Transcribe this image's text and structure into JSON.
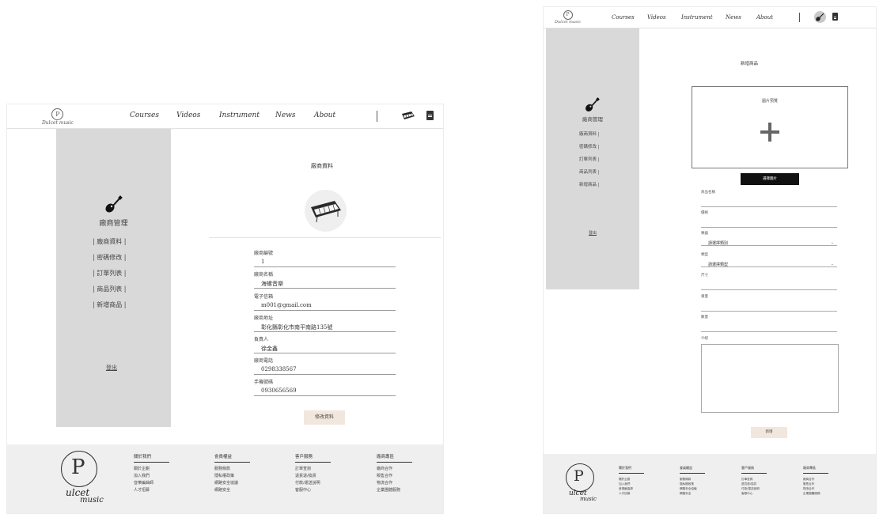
{
  "nav": {
    "brand": "Dulcet music",
    "links": [
      "Courses",
      "Videos",
      "Instrument",
      "News",
      "About"
    ]
  },
  "left_page": {
    "sidebar": {
      "title": "廠商管理",
      "items": [
        "| 廠商資料 |",
        "| 密碼修改 |",
        "| 訂單列表 |",
        "| 商品列表 |",
        "| 新增商品 |"
      ],
      "logout": "登出"
    },
    "heading": "廠商資料",
    "fields": [
      {
        "label": "廠商編號",
        "value": "1"
      },
      {
        "label": "廠商名稱",
        "value": "海螺音樂"
      },
      {
        "label": "電子信箱",
        "value": "m001@gmail.com"
      },
      {
        "label": "廠商地址",
        "value": "彰化縣彰化市南平南路135號"
      },
      {
        "label": "負責人",
        "value": "徐金鑫"
      },
      {
        "label": "廠商電話",
        "value": "0298338567"
      },
      {
        "label": "手機號碼",
        "value": "0930656569"
      }
    ],
    "edit_button": "修改資料"
  },
  "right_page": {
    "sidebar": {
      "title": "廠商管理",
      "items": [
        "廠商資料 |",
        "密碼修改 |",
        "訂單列表 |",
        "商品列表 |",
        "新增商品 |"
      ],
      "logout": "登出"
    },
    "heading": "新增商品",
    "upload_label": "圖片預覽",
    "upload_button": "選擇圖片",
    "fields": [
      {
        "label": "商品名稱",
        "value": ""
      },
      {
        "label": "價格",
        "value": ""
      },
      {
        "label": "樂器",
        "value": "請選擇類別"
      },
      {
        "label": "類型",
        "value": "請選擇類型"
      },
      {
        "label": "尺寸",
        "value": ""
      },
      {
        "label": "重量",
        "value": ""
      },
      {
        "label": "數量",
        "value": ""
      },
      {
        "label": "介紹",
        "value": ""
      }
    ],
    "submit_button": "新增"
  },
  "footer": {
    "brand_line1": "ulcet",
    "brand_line2": "music",
    "columns": [
      {
        "title": "關於我們",
        "items": [
          "關於企劃",
          "加入我們",
          "音樂編曲師",
          "人才招募"
        ]
      },
      {
        "title": "會員權益",
        "items": [
          "服務條款",
          "隱私權政策",
          "網路安全協議",
          "網路安全"
        ]
      },
      {
        "title": "客戶服務",
        "items": [
          "訂單查詢",
          "退貨退/換貨",
          "付款/運送說明",
          "客服中心"
        ]
      },
      {
        "title": "廠商專區",
        "items": [
          "廠商合作",
          "販售合作",
          "物流合作",
          "企業團體服務"
        ]
      }
    ]
  },
  "colors": {
    "sidebar_bg": "#d9d9d9",
    "footer_bg": "#efefef",
    "beige_button": "#f2e7dc",
    "black_button": "#111111"
  }
}
